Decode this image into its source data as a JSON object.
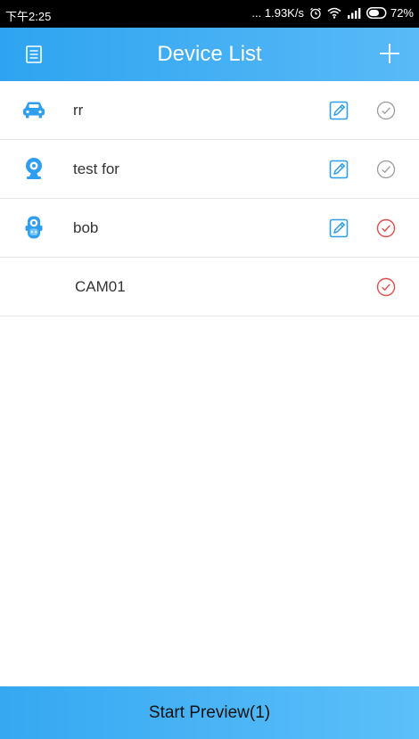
{
  "status_bar": {
    "time": "下午2:25",
    "network": "... 1.93K/s",
    "battery": "72%"
  },
  "header": {
    "title": "Device List",
    "menu_icon": "list-icon",
    "add_icon": "plus-icon"
  },
  "devices": [
    {
      "name": "rr",
      "icon": "car-icon",
      "editable": true,
      "selected": false
    },
    {
      "name": "test for",
      "icon": "webcam-icon",
      "editable": true,
      "selected": false
    },
    {
      "name": "bob",
      "icon": "baby-monitor-icon",
      "editable": true,
      "selected": true
    },
    {
      "name": "CAM01",
      "icon": "",
      "editable": false,
      "selected": true
    }
  ],
  "footer": {
    "start_preview_label": "Start Preview(1)"
  },
  "colors": {
    "header_start": "#2ea4f0",
    "header_end": "#59baf7",
    "accent_blue": "#2e9ef0",
    "selected_red": "#e84c4c",
    "unselected_gray": "#9a9a9a"
  }
}
